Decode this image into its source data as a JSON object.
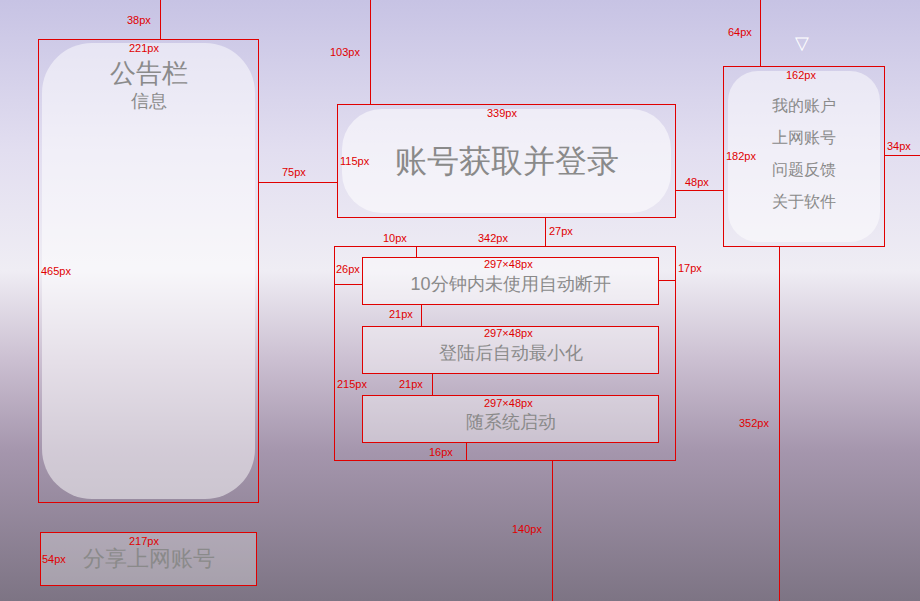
{
  "announcement": {
    "title": "公告栏",
    "subtitle": "信息"
  },
  "share_button": {
    "label": "分享上网账号"
  },
  "login_button": {
    "label": "账号获取并登录"
  },
  "options": [
    {
      "label": "10分钟内未使用自动断开"
    },
    {
      "label": "登陆后自动最小化"
    },
    {
      "label": "随系统启动"
    }
  ],
  "menu": {
    "toggle": "▽",
    "items": [
      "我的账户",
      "上网账号",
      "问题反馈",
      "关于软件"
    ]
  },
  "annotations": [
    "38px",
    "221px",
    "465px",
    "217px",
    "54px",
    "103px",
    "339px",
    "115px",
    "75px",
    "48px",
    "27px",
    "342px",
    "10px",
    "26px",
    "17px",
    "215px",
    "297×48px",
    "297×48px",
    "297×48px",
    "21px",
    "21px",
    "16px",
    "140px",
    "64px",
    "162px",
    "182px",
    "34px",
    "352px"
  ]
}
